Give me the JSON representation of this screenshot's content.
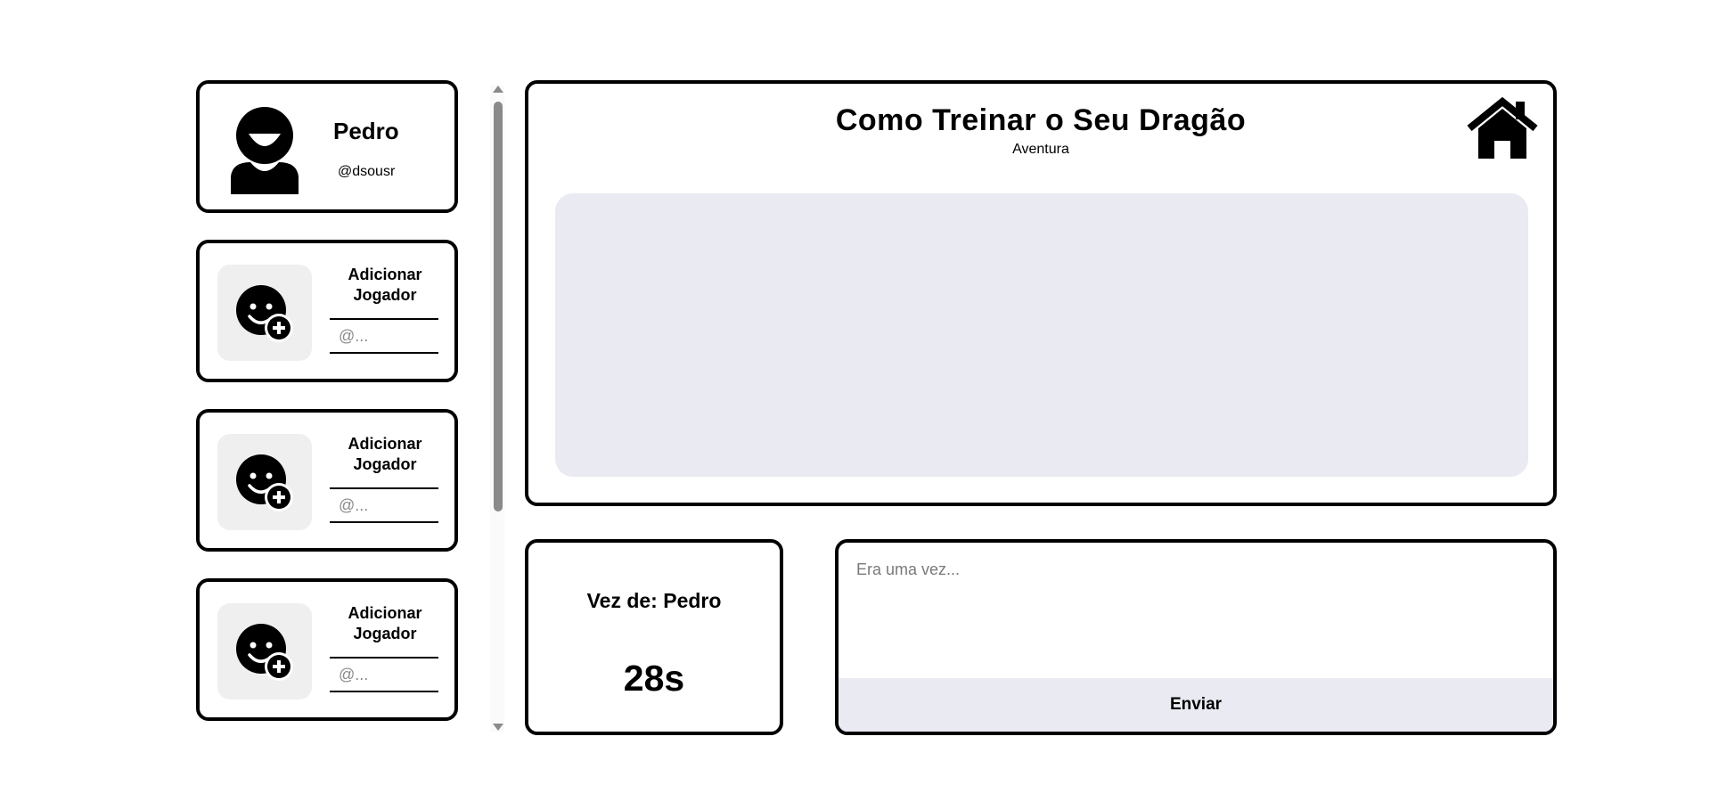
{
  "profile": {
    "name": "Pedro",
    "handle": "@dsousr",
    "avatar_icon": "user-avatar-icon"
  },
  "add_player_cards": [
    {
      "title": "Adicionar Jogador",
      "placeholder": "@...",
      "icon": "add-user-face-icon"
    },
    {
      "title": "Adicionar Jogador",
      "placeholder": "@...",
      "icon": "add-user-face-icon"
    },
    {
      "title": "Adicionar Jogador",
      "placeholder": "@...",
      "icon": "add-user-face-icon"
    }
  ],
  "story": {
    "title": "Como Treinar o Seu Dragão",
    "genre": "Aventura",
    "home_icon": "home-icon"
  },
  "turn": {
    "label": "Vez de: Pedro",
    "timer": "28s"
  },
  "composer": {
    "placeholder": "Era uma vez...",
    "send_label": "Enviar"
  },
  "colors": {
    "panel_fill": "#e9eaf2",
    "icon_box": "#efefef",
    "border": "#000000",
    "scroll_thumb": "#8a8a8a"
  }
}
